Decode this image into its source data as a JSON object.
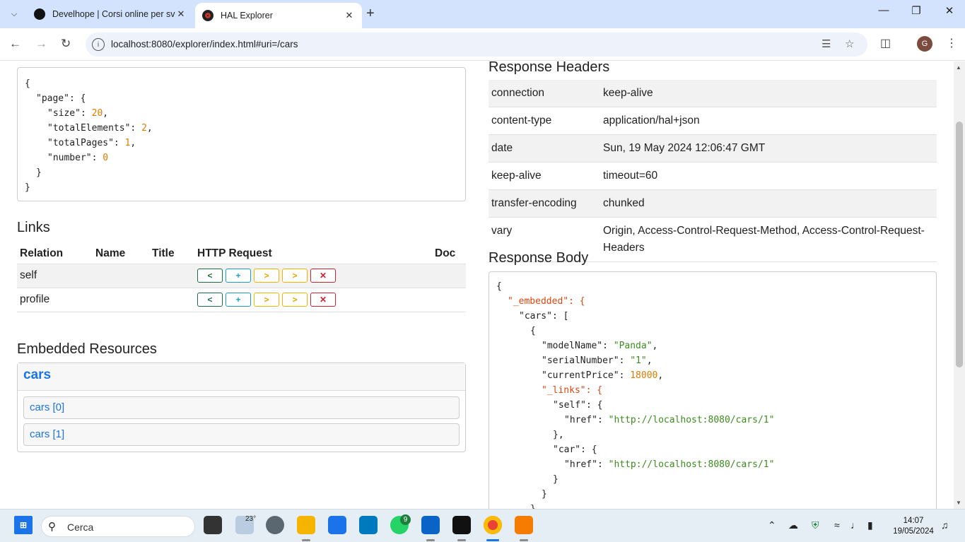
{
  "browser": {
    "tabs": [
      {
        "title": "Develhope | Corsi online per svi",
        "active": false
      },
      {
        "title": "HAL Explorer",
        "active": true
      }
    ],
    "url": "localhost:8080/explorer/index.html#uri=/cars",
    "profile_initial": "G"
  },
  "query_result": {
    "lines": [
      {
        "text": "{"
      },
      {
        "indent": 1,
        "key": "\"page\"",
        "sep": ": {"
      },
      {
        "indent": 2,
        "key": "\"size\"",
        "sep": ": ",
        "num": "20",
        "tail": ","
      },
      {
        "indent": 2,
        "key": "\"totalElements\"",
        "sep": ": ",
        "num": "2",
        "tail": ","
      },
      {
        "indent": 2,
        "key": "\"totalPages\"",
        "sep": ": ",
        "num": "1",
        "tail": ","
      },
      {
        "indent": 2,
        "key": "\"number\"",
        "sep": ": ",
        "num": "0"
      },
      {
        "indent": 1,
        "text": "}"
      },
      {
        "text": "}"
      }
    ]
  },
  "links": {
    "heading": "Links",
    "columns": [
      "Relation",
      "Name",
      "Title",
      "HTTP Request",
      "Doc"
    ],
    "rows": [
      {
        "relation": "self"
      },
      {
        "relation": "profile"
      }
    ]
  },
  "embedded": {
    "heading": "Embedded Resources",
    "group": "cars",
    "items": [
      "cars [0]",
      "cars [1]"
    ]
  },
  "response_headers": {
    "heading": "Response Headers",
    "rows": [
      {
        "name": "connection",
        "value": "keep-alive"
      },
      {
        "name": "content-type",
        "value": "application/hal+json"
      },
      {
        "name": "date",
        "value": "Sun, 19 May 2024 12:06:47 GMT"
      },
      {
        "name": "keep-alive",
        "value": "timeout=60"
      },
      {
        "name": "transfer-encoding",
        "value": "chunked"
      },
      {
        "name": "vary",
        "value": "Origin, Access-Control-Request-Method, Access-Control-Request-Headers"
      }
    ]
  },
  "response_body": {
    "heading": "Response Body",
    "lines": [
      {
        "text": "{"
      },
      {
        "indent": 1,
        "rkey": "\"_embedded\"",
        "sep": ": {"
      },
      {
        "indent": 2,
        "key": "\"cars\"",
        "sep": ": ["
      },
      {
        "indent": 3,
        "text": "{"
      },
      {
        "indent": 4,
        "key": "\"modelName\"",
        "sep": ": ",
        "str": "\"Panda\"",
        "tail": ","
      },
      {
        "indent": 4,
        "key": "\"serialNumber\"",
        "sep": ": ",
        "str": "\"1\"",
        "tail": ","
      },
      {
        "indent": 4,
        "key": "\"currentPrice\"",
        "sep": ": ",
        "num": "18000",
        "tail": ","
      },
      {
        "indent": 4,
        "rkey": "\"_links\"",
        "sep": ": {"
      },
      {
        "indent": 5,
        "key": "\"self\"",
        "sep": ": {"
      },
      {
        "indent": 6,
        "key": "\"href\"",
        "sep": ": ",
        "str": "\"http://localhost:8080/cars/1\""
      },
      {
        "indent": 5,
        "text": "},"
      },
      {
        "indent": 5,
        "key": "\"car\"",
        "sep": ": {"
      },
      {
        "indent": 6,
        "key": "\"href\"",
        "sep": ": ",
        "str": "\"http://localhost:8080/cars/1\""
      },
      {
        "indent": 5,
        "text": "}"
      },
      {
        "indent": 4,
        "text": "}"
      },
      {
        "indent": 3,
        "text": "},"
      }
    ]
  },
  "taskbar": {
    "search_placeholder": "Cerca",
    "weather_temp": "23°",
    "whatsapp_badge": "9",
    "time": "14:07",
    "date": "19/05/2024"
  }
}
